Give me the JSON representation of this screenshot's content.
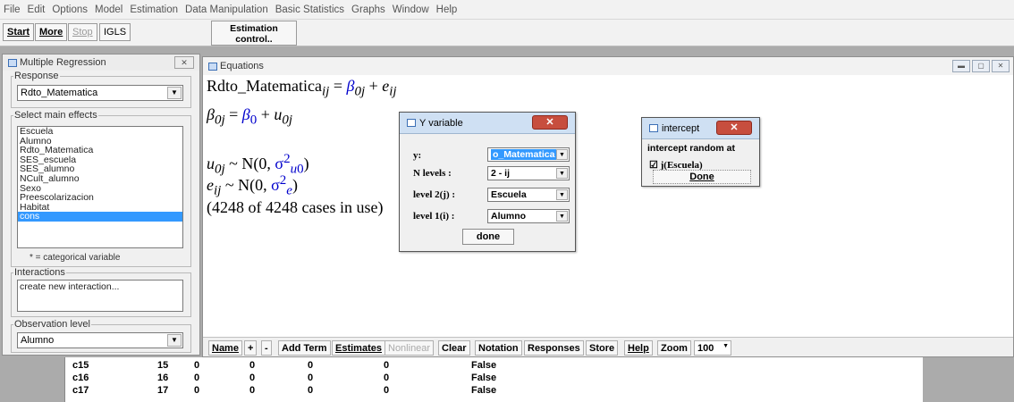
{
  "menu": [
    "File",
    "Edit",
    "Options",
    "Model",
    "Estimation",
    "Data Manipulation",
    "Basic Statistics",
    "Graphs",
    "Window",
    "Help"
  ],
  "toolbar": {
    "start": "Start",
    "more": "More",
    "stop": "Stop",
    "method": "IGLS",
    "estimation_control": "Estimation control.."
  },
  "mr_panel": {
    "title": "Multiple Regression",
    "response_legend": "Response",
    "response_value": "Rdto_Matematica",
    "effects_legend": "Select main effects",
    "effects": [
      "Escuela",
      "Alumno",
      "Rdto_Matematica",
      "SES_escuela",
      "SES_alumno",
      "NCult_alumno",
      "Sexo",
      "Preescolarizacion",
      "Habitat",
      "cons"
    ],
    "selected_effect": "cons",
    "categorical_note": "* = categorical variable",
    "interactions_legend": "Interactions",
    "interactions_item": "create new interaction...",
    "observation_legend": "Observation level",
    "observation_value": "Alumno"
  },
  "equations": {
    "title": "Equations",
    "cases_text": "(4248 of 4248 cases in use)",
    "buttons": {
      "name": "Name",
      "plus": "+",
      "minus": "-",
      "add_term": "Add Term",
      "estimates": "Estimates",
      "nonlinear": "Nonlinear",
      "clear": "Clear",
      "notation": "Notation",
      "responses": "Responses",
      "store": "Store",
      "help": "Help",
      "zoom_label": "Zoom",
      "zoom_value": "100"
    }
  },
  "yvar": {
    "title": "Y variable",
    "y_label": "y:",
    "y_value": "o_Matematica",
    "nlevels_label": "N levels :",
    "nlevels_value": "2 - ij",
    "level2_label": "level 2(j) :",
    "level2_value": "Escuela",
    "level1_label": "level 1(i) :",
    "level1_value": "Alumno",
    "done": "done"
  },
  "intercept": {
    "title": "intercept",
    "random_label": "intercept random at",
    "checkbox_label": "j(Escuela)",
    "done": "Done"
  },
  "data_rows": [
    {
      "name": "c15",
      "n": "15",
      "a": "0",
      "b": "0",
      "c": "0",
      "d": "0",
      "cat": "False"
    },
    {
      "name": "c16",
      "n": "16",
      "a": "0",
      "b": "0",
      "c": "0",
      "d": "0",
      "cat": "False"
    },
    {
      "name": "c17",
      "n": "17",
      "a": "0",
      "b": "0",
      "c": "0",
      "d": "0",
      "cat": "False"
    }
  ]
}
